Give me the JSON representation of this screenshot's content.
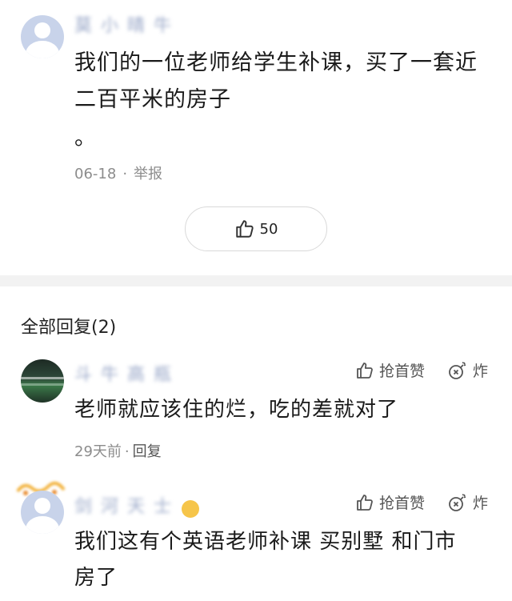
{
  "comment": {
    "username": "莫 小 晴 牛",
    "text_line1": "我们的一位老师给学生补课，买了一套近",
    "text_line2": "二百平米的房子",
    "text_line3": "。",
    "date": "06-18",
    "separator": "·",
    "report_label": "举报",
    "like_count": "50"
  },
  "replies_section": {
    "title": "全部回复(2)"
  },
  "replies": [
    {
      "username": "斗 牛 高 瓶",
      "like_label": "抢首赞",
      "bomb_label": "炸",
      "text": "老师就应该住的烂，吃的差就对了",
      "time": "29天前",
      "separator": "·",
      "reply_label": "回复"
    },
    {
      "username": "剑 河 天 士",
      "like_label": "抢首赞",
      "bomb_label": "炸",
      "text": "我们这有个英语老师补课 买别墅  和门市",
      "text_line2": "房了"
    }
  ],
  "icons": {
    "thumb": "thumbs-up-icon",
    "bomb": "bomb-icon"
  },
  "colors": {
    "avatar_default": "#c8d3ea",
    "divider": "#f2f2f2",
    "meta_text": "#8c8c8c"
  }
}
